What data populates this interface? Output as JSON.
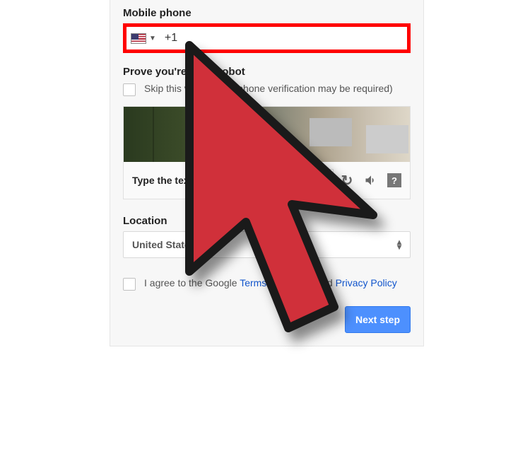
{
  "mobile": {
    "label": "Mobile phone",
    "dial_code": "+1",
    "country_icon": "us-flag-icon"
  },
  "robot": {
    "label": "Prove you're not a robot",
    "skip_text": "Skip this verification (phone verification may be required)",
    "type_label": "Type the text:"
  },
  "captcha_icons": {
    "refresh": "↻",
    "audio": "🔊",
    "help": "?"
  },
  "location": {
    "label": "Location",
    "selected": "United States"
  },
  "agree": {
    "pre": "I agree to the Google ",
    "tos": "Terms of Service",
    "mid": " and ",
    "pp": "Privacy Policy"
  },
  "buttons": {
    "next": "Next step"
  }
}
